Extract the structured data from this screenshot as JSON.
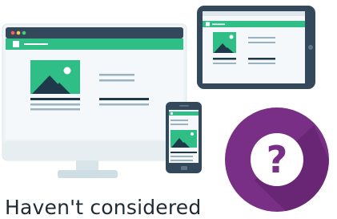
{
  "caption": "Haven't considered",
  "colors": {
    "monitor_frame": "#33495b",
    "screen_bg": "#eef2f4",
    "accent_green": "#2fbf86",
    "dark_line": "#1e3a4a",
    "muted_line": "#9ab2bf",
    "purple": "#7a2f86",
    "purple_dark": "#5b1f66",
    "question_bg": "#ffffff",
    "question_fg": "#7a2f86"
  },
  "icons": {
    "monitor": "desktop-monitor-icon",
    "tablet": "tablet-icon",
    "phone": "phone-icon",
    "help": "question-mark-icon"
  },
  "question_glyph": "?"
}
